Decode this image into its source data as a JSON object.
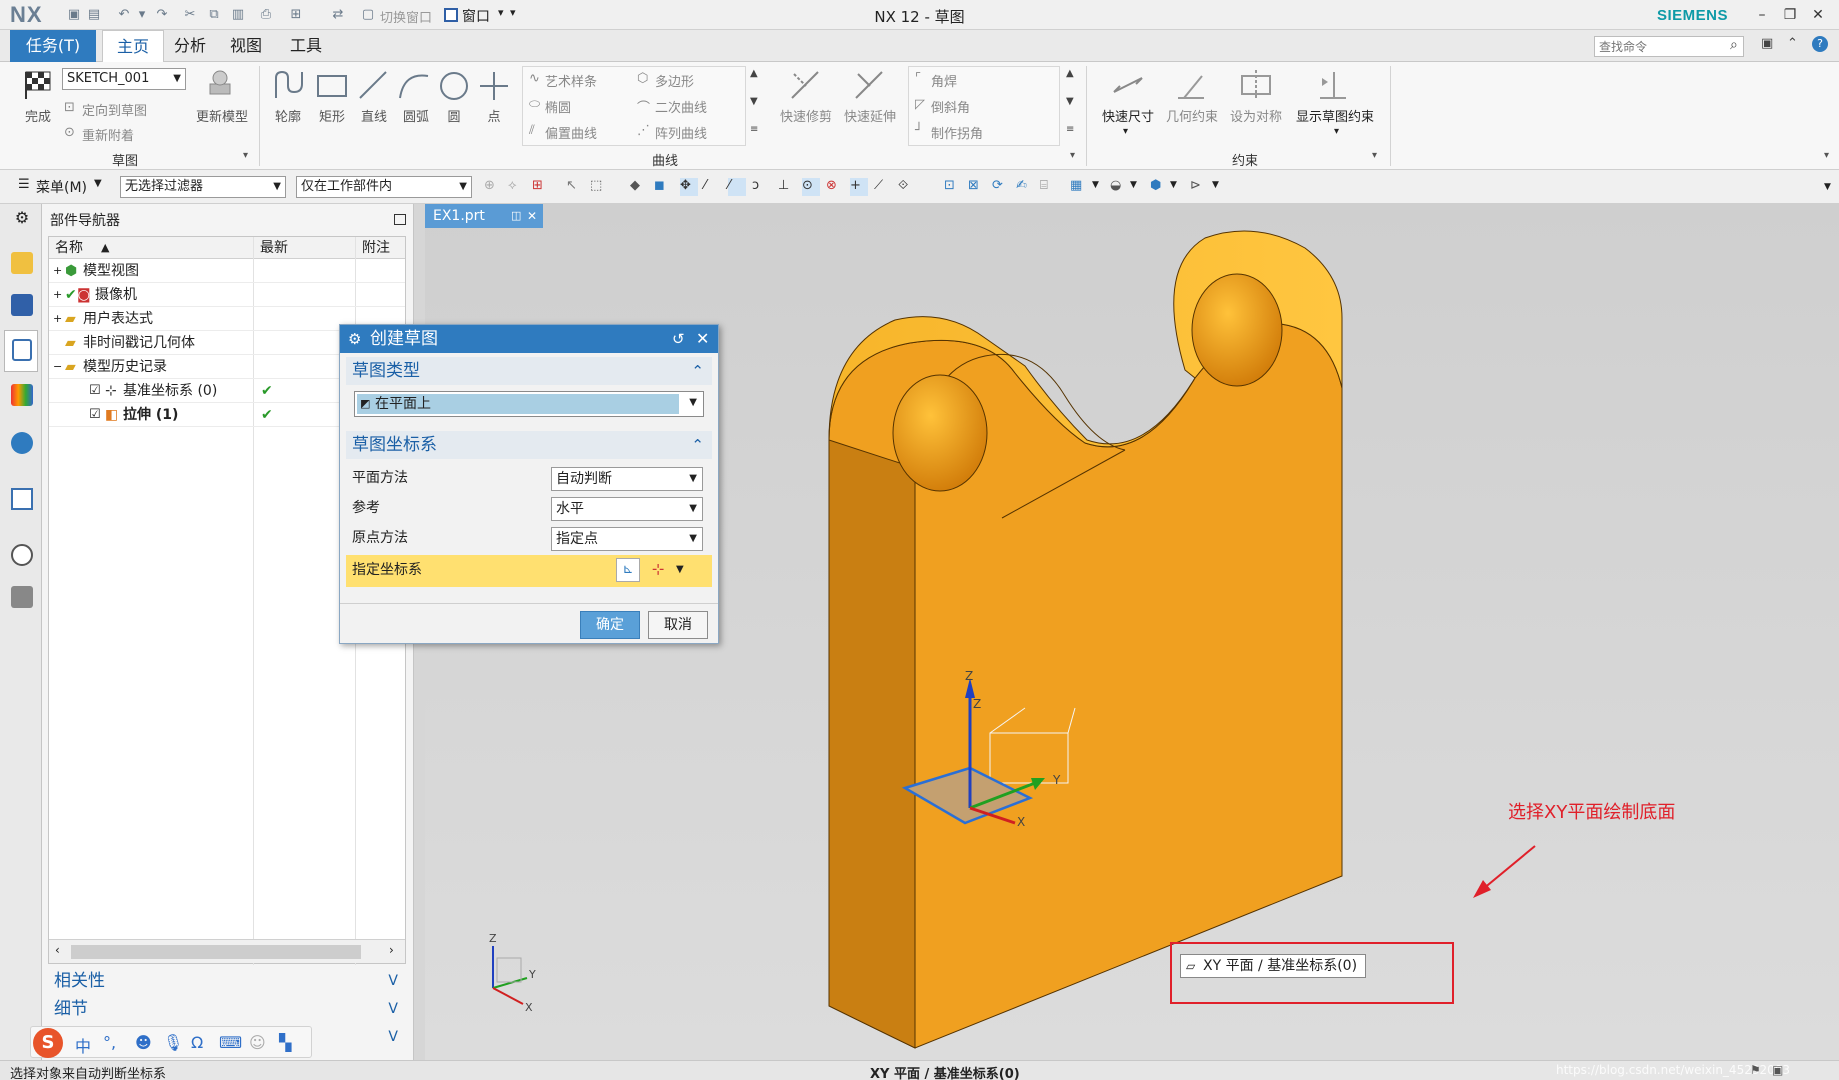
{
  "app": {
    "logo": "NX",
    "title": "NX 12 - 草图",
    "brand": "SIEMENS"
  },
  "quick_access": {
    "switch_window": "切换窗口",
    "window": "窗口"
  },
  "tabs": {
    "task": "任务(T)",
    "home": "主页",
    "analysis": "分析",
    "view": "视图",
    "tools": "工具"
  },
  "search": {
    "placeholder": "查找命令"
  },
  "ribbon": {
    "sketch_group": {
      "title": "草图",
      "finish": "完成",
      "sketch_name": "SKETCH_001",
      "orient": "定向到草图",
      "reattach": "重新附着",
      "update_model": "更新模型"
    },
    "curve_group": {
      "title": "曲线",
      "profile": "轮廓",
      "rectangle": "矩形",
      "line": "直线",
      "arc": "圆弧",
      "circle": "圆",
      "point": "点",
      "studio_spline": "艺术样条",
      "polygon": "多边形",
      "ellipse": "椭圆",
      "conic": "二次曲线",
      "offset_curve": "偏置曲线",
      "pattern_curve": "阵列曲线",
      "quick_trim": "快速修剪",
      "quick_extend": "快速延伸",
      "fillet": "角焊",
      "chamfer": "倒斜角",
      "make_corner": "制作拐角"
    },
    "constraints_group": {
      "title": "约束",
      "rapid_dim": "快速尺寸",
      "geo_constraint": "几何约束",
      "make_symmetric": "设为对称",
      "show_constraints": "显示草图约束"
    }
  },
  "toolbar2": {
    "menu": "菜单(M)",
    "filter": "无选择过滤器",
    "scope": "仅在工作部件内"
  },
  "navigator": {
    "title": "部件导航器",
    "columns": {
      "name": "名称",
      "latest": "最新",
      "comment": "附注"
    },
    "rows": [
      {
        "name": "模型视图"
      },
      {
        "name": "摄像机"
      },
      {
        "name": "用户表达式"
      },
      {
        "name": "非时间戳记几何体"
      },
      {
        "name": "模型历史记录"
      },
      {
        "name": "基准坐标系 (0)",
        "check": "✔"
      },
      {
        "name": "拉伸 (1)",
        "check": "✔"
      }
    ],
    "accordions": {
      "dependencies": "相关性",
      "details": "细节"
    }
  },
  "viewport_tab": {
    "file": "EX1.prt"
  },
  "dialog": {
    "title": "创建草图",
    "section_type": "草图类型",
    "type_value": "在平面上",
    "section_csys": "草图坐标系",
    "plane_method_label": "平面方法",
    "plane_method_value": "自动判断",
    "reference_label": "参考",
    "reference_value": "水平",
    "origin_method_label": "原点方法",
    "origin_method_value": "指定点",
    "specify_csys_label": "指定坐标系",
    "ok": "确定",
    "cancel": "取消"
  },
  "annotation": {
    "text": "选择XY平面绘制底面",
    "tooltip": "XY 平面 / 基准坐标系(0)"
  },
  "status": {
    "left": "选择对象来自动判断坐标系",
    "center": "XY 平面 / 基准坐标系(0)",
    "watermark": "https://blog.csdn.net/weixin_45232003"
  },
  "ime": {
    "mode": "中"
  },
  "colors": {
    "accent": "#2f7bbf",
    "part": "#f5a31a",
    "highlight": "#ffe070",
    "annotation": "#e0202a"
  }
}
